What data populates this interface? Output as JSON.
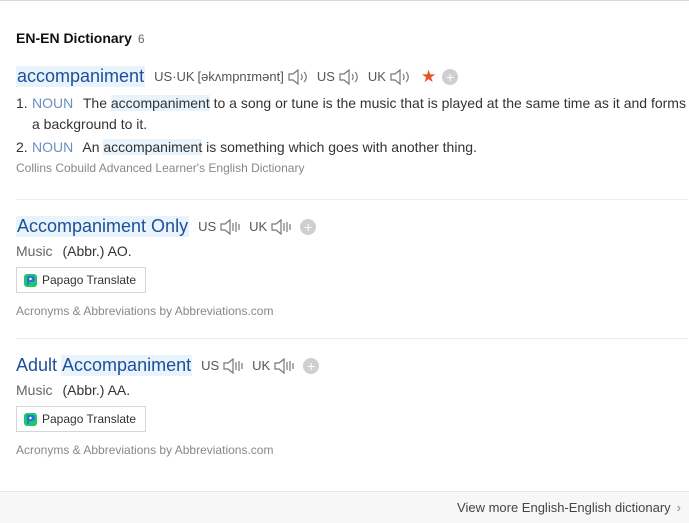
{
  "heading": {
    "title": "EN-EN Dictionary",
    "count": "6"
  },
  "entry1": {
    "headword": "accompaniment",
    "pron_label": "US·UK",
    "ipa": "[əkʌmpnɪmənt]",
    "us": "US",
    "uk": "UK",
    "senses": [
      {
        "num": "1.",
        "pos": "NOUN",
        "pre": "The",
        "hl": "accompaniment",
        "post": "to a song or tune is the music that is played at the same time as it and forms a background to it."
      },
      {
        "num": "2.",
        "pos": "NOUN",
        "pre": "An",
        "hl": "accompaniment",
        "post": "is something which goes with another thing."
      }
    ],
    "source": "Collins Cobuild Advanced Learner's English Dictionary"
  },
  "entry2": {
    "headword": "Accompaniment Only",
    "us": "US",
    "uk": "UK",
    "category": "Music",
    "definition": "(Abbr.) AO.",
    "translate": "Papago Translate",
    "source": "Acronyms & Abbreviations by Abbreviations.com"
  },
  "entry3": {
    "word1": "Adult",
    "word2": "Accompaniment",
    "us": "US",
    "uk": "UK",
    "category": "Music",
    "definition": "(Abbr.) AA.",
    "translate": "Papago Translate",
    "source": "Acronyms & Abbreviations by Abbreviations.com"
  },
  "footer": {
    "more": "View more English-English dictionary"
  },
  "icons": {
    "speaker": "speaker-icon",
    "add": "plus-icon",
    "favorite": "star-icon",
    "papago": "papago-icon",
    "chevron": "chevron-right-icon"
  },
  "colors": {
    "headword": "#1e4f9a",
    "highlight": "#e8f3fb",
    "star": "#e2552d",
    "pos": "#6a8fbf"
  }
}
